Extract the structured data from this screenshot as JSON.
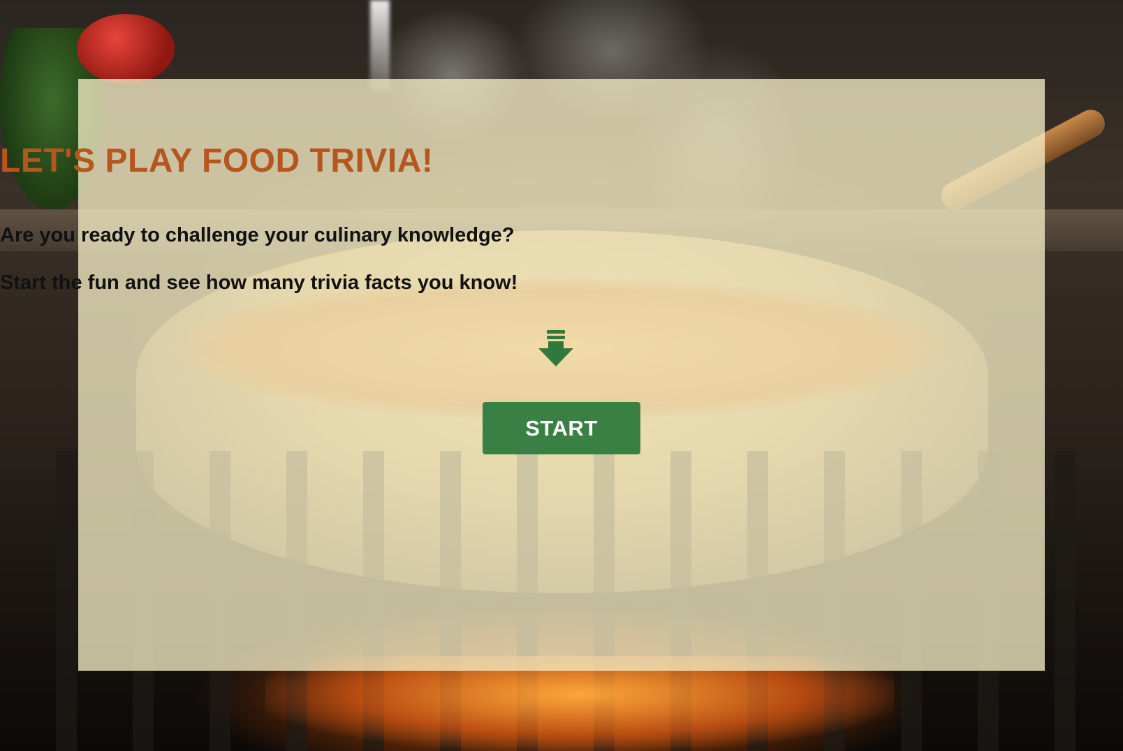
{
  "intro": {
    "title": "LET'S PLAY FOOD TRIVIA!",
    "line_one": "Are you ready to challenge your culinary knowledge?",
    "line_two": "Start the fun and see how many trivia facts you know!",
    "arrow_icon": "arrow-down-icon",
    "start_label": "START"
  },
  "colors": {
    "title": "#b5561f",
    "button": "#3a8044",
    "arrow": "#2f7a3b",
    "overlay": "#f3ecc4"
  }
}
